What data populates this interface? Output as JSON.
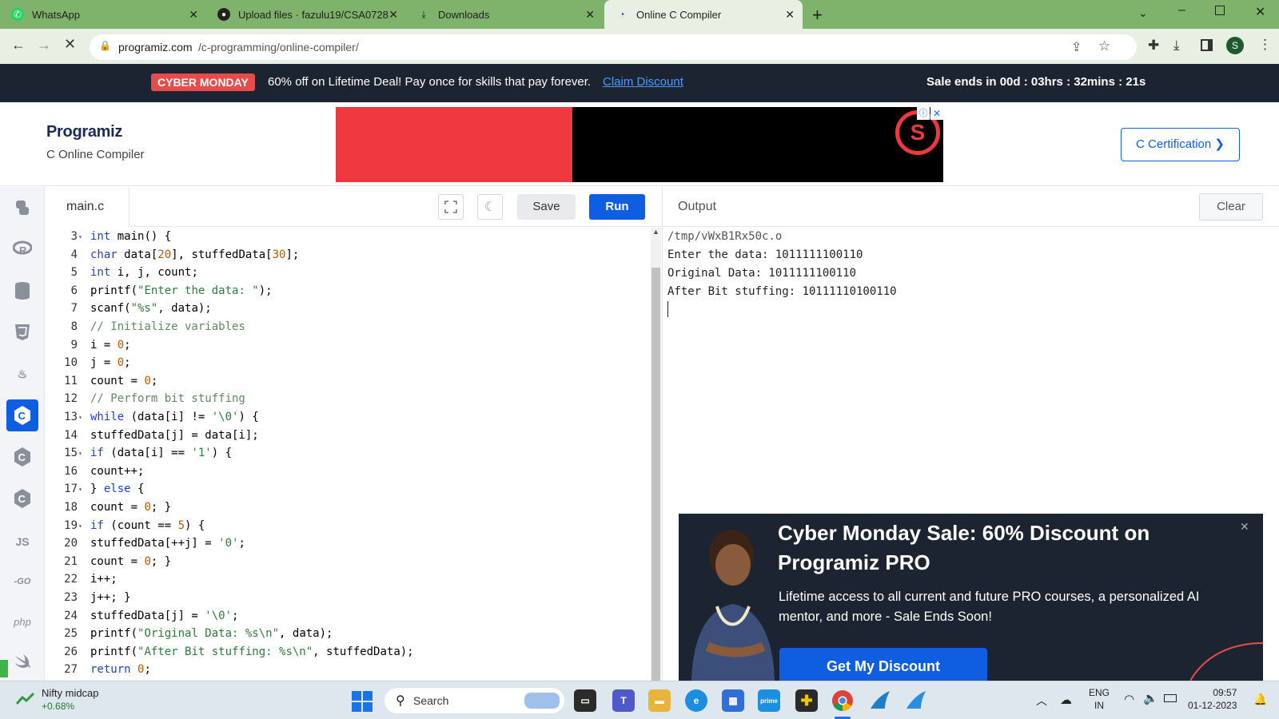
{
  "browser": {
    "tabs": [
      {
        "title": "WhatsApp"
      },
      {
        "title": "Upload files · fazulu19/CSA0728"
      },
      {
        "title": "Downloads"
      },
      {
        "title": "Online C Compiler"
      }
    ],
    "url_domain": "programiz.com",
    "url_path": "/c-programming/online-compiler/",
    "profile_initial": "S"
  },
  "promo": {
    "badge": "CYBER MONDAY",
    "text": "60% off on Lifetime Deal! Pay once for skills that pay forever.",
    "link": "Claim Discount",
    "countdown": "Sale ends in 00d : 03hrs : 32mins : 21s"
  },
  "header": {
    "logo": "Programiz",
    "subtitle": "C Online Compiler",
    "cert_button": "C Certification ❯"
  },
  "rail": {
    "js_label": "JS",
    "go_label": "-GO",
    "php_label": "php"
  },
  "editor": {
    "filename": "main.c",
    "save": "Save",
    "run": "Run",
    "lines": [
      {
        "n": "3",
        "fold": true,
        "html": "<span class='kw'>int</span> main() {"
      },
      {
        "n": "4",
        "fold": false,
        "html": "<span class='kw'>char</span> data[<span class='num'>20</span>], stuffedData[<span class='num'>30</span>];"
      },
      {
        "n": "5",
        "fold": false,
        "html": "<span class='kw'>int</span> i, j, count;"
      },
      {
        "n": "6",
        "fold": false,
        "html": "printf(<span class='str'>\"Enter the data: \"</span>);"
      },
      {
        "n": "7",
        "fold": false,
        "html": "scanf(<span class='str'>\"%s\"</span>, data);"
      },
      {
        "n": "8",
        "fold": false,
        "html": "<span class='cm'>// Initialize variables</span>"
      },
      {
        "n": "9",
        "fold": false,
        "html": "i = <span class='num'>0</span>;"
      },
      {
        "n": "10",
        "fold": false,
        "html": "j = <span class='num'>0</span>;"
      },
      {
        "n": "11",
        "fold": false,
        "html": "count = <span class='num'>0</span>;"
      },
      {
        "n": "12",
        "fold": false,
        "html": "<span class='cm'>// Perform bit stuffing</span>"
      },
      {
        "n": "13",
        "fold": true,
        "html": "<span class='kw'>while</span> (data[i] != <span class='str'>'\\0'</span>) {"
      },
      {
        "n": "14",
        "fold": false,
        "html": "stuffedData[j] = data[i];"
      },
      {
        "n": "15",
        "fold": true,
        "html": "<span class='kw'>if</span> (data[i] == <span class='str'>'1'</span>) {"
      },
      {
        "n": "16",
        "fold": false,
        "html": "count++;"
      },
      {
        "n": "17",
        "fold": true,
        "html": "} <span class='kw'>else</span> {"
      },
      {
        "n": "18",
        "fold": false,
        "html": "count = <span class='num'>0</span>; }"
      },
      {
        "n": "19",
        "fold": true,
        "html": "<span class='kw'>if</span> (count == <span class='num'>5</span>) {"
      },
      {
        "n": "20",
        "fold": false,
        "html": "stuffedData[++j] = <span class='str'>'0'</span>;"
      },
      {
        "n": "21",
        "fold": false,
        "html": "count = <span class='num'>0</span>; }"
      },
      {
        "n": "22",
        "fold": false,
        "html": "i++;"
      },
      {
        "n": "23",
        "fold": false,
        "html": "j++; }"
      },
      {
        "n": "24",
        "fold": false,
        "html": "stuffedData[j] = <span class='str'>'\\0'</span>;"
      },
      {
        "n": "25",
        "fold": false,
        "html": "printf(<span class='str'>\"Original Data: %s\\n\"</span>, data);"
      },
      {
        "n": "26",
        "fold": false,
        "html": "printf(<span class='str'>\"After Bit stuffing: %s\\n\"</span>, stuffedData);"
      },
      {
        "n": "27",
        "fold": false,
        "html": "<span class='kw'>return</span> <span class='num'>0</span>;"
      }
    ]
  },
  "output": {
    "title": "Output",
    "clear": "Clear",
    "lines": [
      "/tmp/vWxB1Rx50c.o",
      "Enter the data: 1011111100110",
      "Original Data: 1011111100110",
      "After Bit stuffing: 10111110100110"
    ]
  },
  "popup": {
    "title": "Cyber Monday Sale: 60% Discount on Programiz PRO",
    "body": "Lifetime access to all current and future PRO courses, a personalized AI mentor, and more - Sale Ends Soon!",
    "cta": "Get My Discount"
  },
  "taskbar": {
    "widget_title": "Nifty midcap",
    "widget_value": "+0.68%",
    "search": "Search",
    "lang": "ENG",
    "region": "IN",
    "time": "09:57",
    "date": "01-12-2023"
  },
  "colors": {
    "accent": "#0f5de0",
    "promo_bg": "#1c2432",
    "badge": "#e74c4c",
    "tabbar": "#7fb26a"
  }
}
